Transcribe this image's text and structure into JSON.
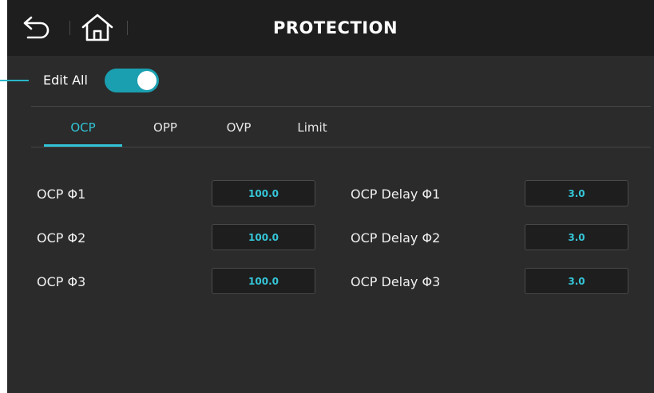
{
  "header": {
    "title": "PROTECTION",
    "back_icon": "back-arrow-icon",
    "home_icon": "home-icon"
  },
  "edit_all": {
    "label": "Edit All",
    "enabled": true,
    "accent_color": "#29b6c8"
  },
  "tabs": [
    {
      "label": "OCP",
      "active": true
    },
    {
      "label": "OPP",
      "active": false
    },
    {
      "label": "OVP",
      "active": false
    },
    {
      "label": "Limit",
      "active": false
    }
  ],
  "ocp": {
    "left": [
      {
        "label": "OCP Φ1",
        "value": "100.0"
      },
      {
        "label": "OCP Φ2",
        "value": "100.0"
      },
      {
        "label": "OCP Φ3",
        "value": "100.0"
      }
    ],
    "right": [
      {
        "label": "OCP Delay Φ1",
        "value": "3.0"
      },
      {
        "label": "OCP Delay Φ2",
        "value": "3.0"
      },
      {
        "label": "OCP Delay Φ3",
        "value": "3.0"
      }
    ]
  }
}
